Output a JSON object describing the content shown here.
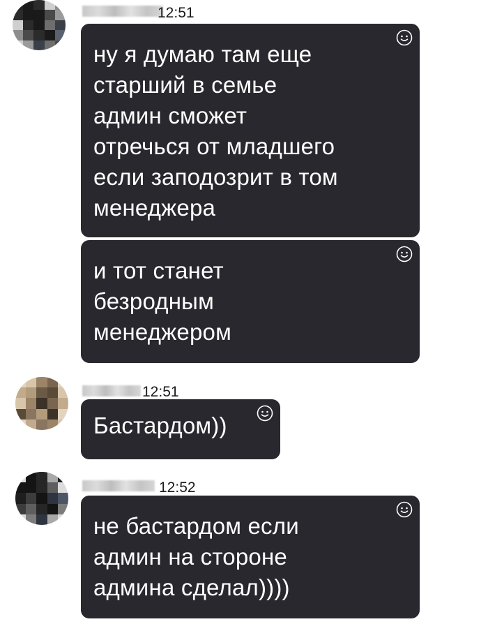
{
  "messages": [
    {
      "time": "12:51",
      "bubbles": [
        {
          "lines": [
            "ну я думаю там еще",
            "старший в семье",
            "админ сможет",
            "отречься от младшего",
            "если заподозрит в том",
            "менеджера"
          ]
        },
        {
          "lines": [
            "и тот станет",
            "безродным",
            "менеджером"
          ]
        }
      ]
    },
    {
      "time": "12:51",
      "bubbles": [
        {
          "lines": [
            "Бастардом))"
          ]
        }
      ]
    },
    {
      "time": "12:52",
      "bubbles": [
        {
          "lines": [
            "не бастардом если",
            "админ на стороне",
            "админа сделал))))"
          ]
        }
      ]
    }
  ],
  "icons": {
    "reaction": "smiley-icon"
  },
  "colors": {
    "bubble_bg": "#28282e",
    "bubble_text": "#ffffff",
    "page_bg": "#ffffff",
    "time_text": "#1a1a1a"
  }
}
